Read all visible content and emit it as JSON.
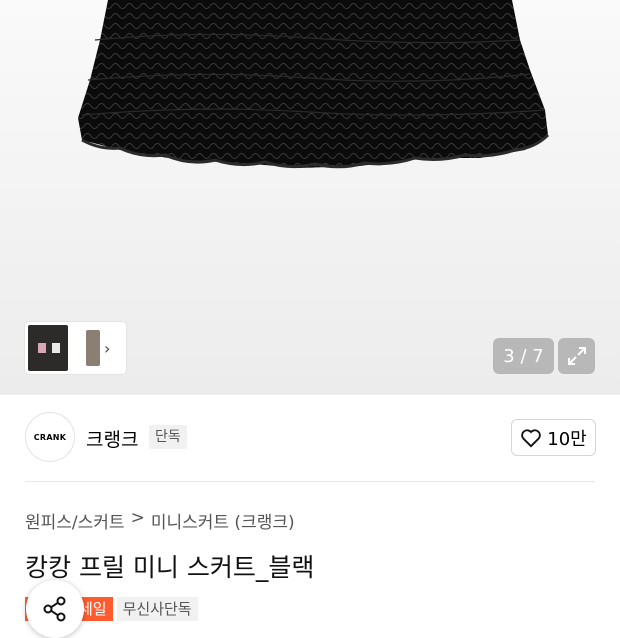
{
  "gallery": {
    "counter": "3 / 7",
    "thumbnail_arrow": "›",
    "icons": {
      "expand": "expand-icon",
      "thumb_arrow": "chevron-right-icon"
    }
  },
  "brand": {
    "logo_text": "CRANK",
    "name": "크랭크",
    "badge": "단독",
    "likes": "10만",
    "icons": {
      "like": "heart-icon"
    }
  },
  "product": {
    "breadcrumb": [
      "원피스/스커트",
      "미니스커트 (크랭크)"
    ],
    "breadcrumb_separator": ">",
    "title": "캉캉 프릴 미니 스커트_블랙",
    "tags": [
      {
        "label": "세일",
        "color": "#ff5b2e"
      },
      {
        "label": "무신사단독",
        "color": "#f1f1f1"
      }
    ]
  },
  "floating": {
    "icons": {
      "share": "share-icon"
    }
  },
  "colors": {
    "accent": "#ff5b2e",
    "hero_bg": "#f1f1f1",
    "skirt": "#0d0d0d"
  }
}
